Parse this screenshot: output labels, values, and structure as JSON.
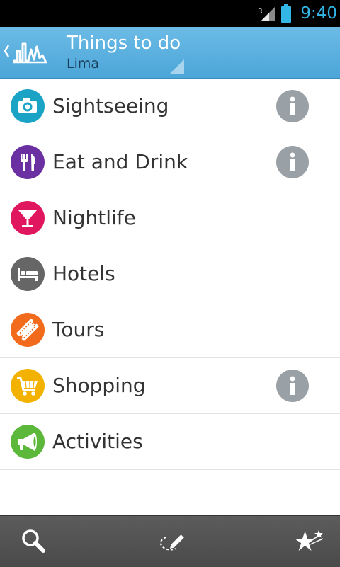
{
  "status_bar": {
    "time": "9:40",
    "roaming_indicator": "R",
    "icons": [
      "signal-icon",
      "battery-icon"
    ],
    "accent_color": "#33b5e5"
  },
  "action_bar": {
    "title": "Things to do",
    "subtitle": "Lima",
    "icons": [
      "back-chevron-icon",
      "app-logo-icon",
      "spinner-arrow-icon"
    ],
    "background_color": "#5aafde"
  },
  "categories": [
    {
      "label": "Sightseeing",
      "icon": "camera-icon",
      "color": "#1ba3c6",
      "has_info": true
    },
    {
      "label": "Eat and Drink",
      "icon": "fork-knife-icon",
      "color": "#6a2fa0",
      "has_info": true
    },
    {
      "label": "Nightlife",
      "icon": "cocktail-icon",
      "color": "#e0175e",
      "has_info": false
    },
    {
      "label": "Hotels",
      "icon": "bed-icon",
      "color": "#666666",
      "has_info": false
    },
    {
      "label": "Tours",
      "icon": "ticket-icon",
      "color": "#f26b1d",
      "has_info": false
    },
    {
      "label": "Shopping",
      "icon": "cart-icon",
      "color": "#f3b200",
      "has_info": true
    },
    {
      "label": "Activities",
      "icon": "megaphone-icon",
      "color": "#5cb83a",
      "has_info": false
    }
  ],
  "bottom_bar": {
    "buttons": [
      "search-icon",
      "route-pen-icon",
      "stars-icon"
    ],
    "background_color": "#555555"
  }
}
